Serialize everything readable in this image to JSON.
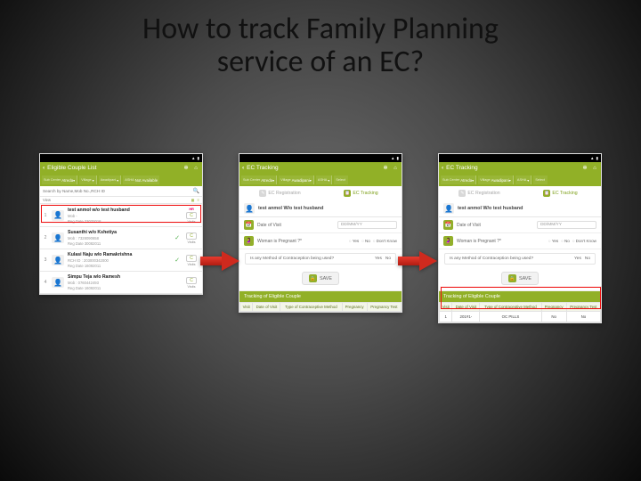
{
  "title_line1": "How to track Family Planning",
  "title_line2": "service of an EC?",
  "status": {
    "battery": "█",
    "signal": "▮",
    "time": ""
  },
  "screen1": {
    "header": "Eligible Couple List",
    "filters": {
      "f1_label": "Sub Center",
      "f1_val": "Atreda",
      "f2_label": "Village",
      "f2_val": "",
      "f3_label": "Awadipani",
      "f3_val": "",
      "f4_label": "ASHA",
      "f4_val": "Not Available"
    },
    "search_placeholder": "Search by Name,Mob No.,RCH ID",
    "view_label": "View",
    "rows": [
      {
        "num": "1",
        "name": "test anmol w/o test husband",
        "sub1": "Mob -",
        "sub2": "Reg Date 23032018",
        "high": "HR",
        "c": "C",
        "visits": "Visits"
      },
      {
        "num": "2",
        "name": "Susanthi w/o Kshetiya",
        "sub1": "Mob : 7328090658",
        "sub2": "Reg Date 30082011",
        "high": "",
        "c": "C",
        "visits": "Visits",
        "tick": true
      },
      {
        "num": "3",
        "name": "Kulasi Naju w/o Ramakrishna",
        "sub1": "RCH ID : 203000342000",
        "sub2": "Reg Date 16092011",
        "high": "",
        "c": "C",
        "visits": "Visits",
        "tick": true
      },
      {
        "num": "4",
        "name": "Simpu Teja w/o Ramesh",
        "sub1": "Mob : 0760442493",
        "sub2": "Reg Date 16092011",
        "high": "",
        "c": "C",
        "visits": "Visits"
      }
    ]
  },
  "screen2": {
    "header": "EC Tracking",
    "filters": {
      "f1_label": "Sub Center",
      "f1_val": "Atreda",
      "f2_label": "Village",
      "f2_val": "Awadipani",
      "f3_label": "ASHA",
      "f4_label": "Select"
    },
    "tab_reg": "EC Registration",
    "tab_track": "EC Tracking",
    "couple_name": "test anmol W/o test husband",
    "dov_label": "Date of Visit",
    "dov_value": "DD/MM/YY",
    "preg_label": "Woman is Pregnant ?*",
    "preg_opts": [
      "Yes",
      "No",
      "Don't Know"
    ],
    "method_q": "Is any Method of Contraception being used?",
    "method_opts": [
      "Yes",
      "No"
    ],
    "save": "SAVE",
    "track_header": "Tracking of Eligible Couple",
    "cols": [
      "Visit",
      "Date of Visit",
      "Type of Contraceptive Method",
      "Pregnancy",
      "Pregnancy Test"
    ]
  },
  "screen3": {
    "row": {
      "visit": "1",
      "date": "201#1-",
      "method": "OC PILLS",
      "preg": "No",
      "test": "No"
    }
  },
  "chart_data": {
    "type": "table",
    "title": "Tracking of Eligible Couple",
    "columns": [
      "Visit",
      "Date of Visit",
      "Type of Contraceptive Method",
      "Pregnancy",
      "Pregnancy Test"
    ],
    "rows": [
      [
        "1",
        "201#1-",
        "OC PILLS",
        "No",
        "No"
      ]
    ]
  }
}
